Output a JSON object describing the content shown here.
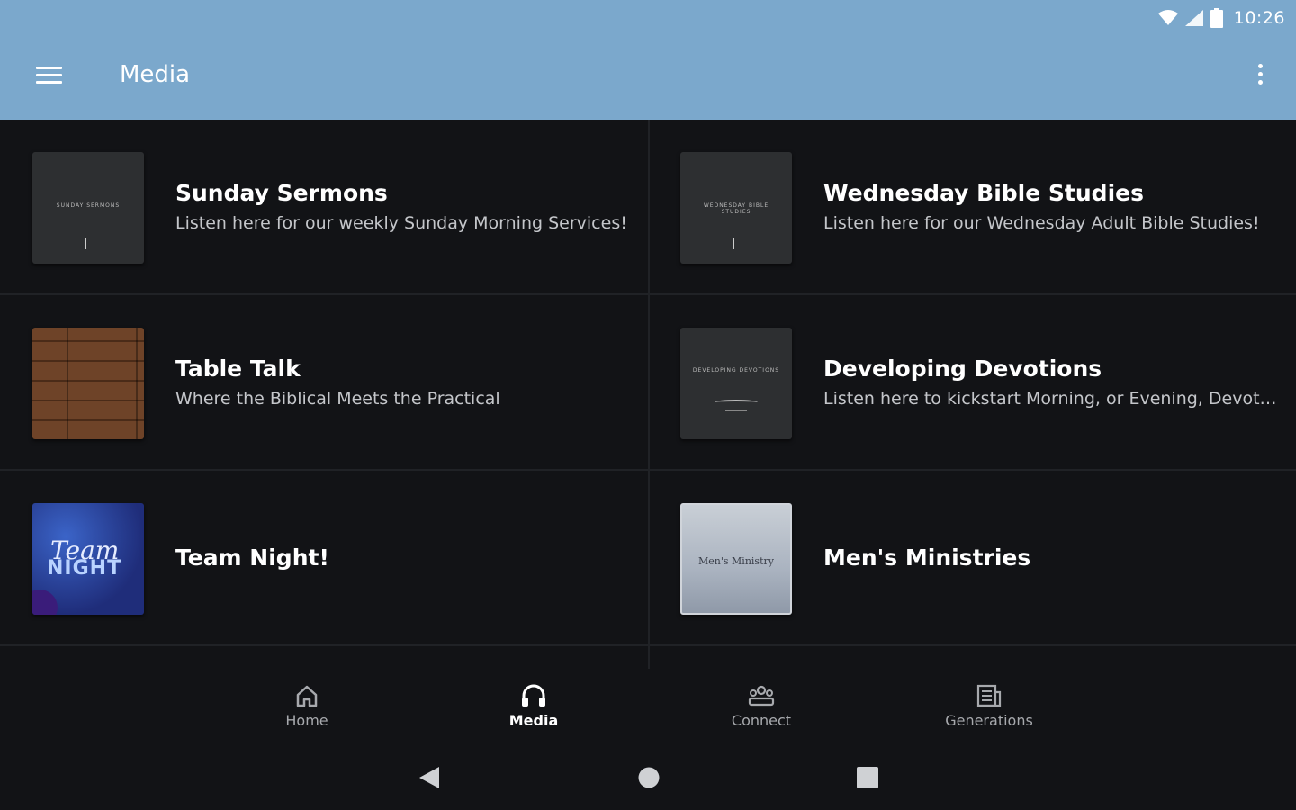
{
  "status_bar": {
    "time": "10:26",
    "icons": [
      "wifi-icon",
      "signal-icon",
      "battery-icon"
    ]
  },
  "app_bar": {
    "title": "Media",
    "background": "#7ba8cc",
    "menu_icon": "hamburger-menu-icon",
    "overflow_icon": "more-vert-icon"
  },
  "media_items": [
    {
      "title": "Sunday Sermons",
      "subtitle": "Listen here for our weekly Sunday Morning Services!",
      "thumb_text": "SUNDAY SERMONS"
    },
    {
      "title": "Wednesday Bible Studies",
      "subtitle": "Listen here for our Wednesday Adult Bible Studies!",
      "thumb_text": "WEDNESDAY BIBLE STUDIES"
    },
    {
      "title": "Table Talk",
      "subtitle": "Where the Biblical Meets the Practical"
    },
    {
      "title": "Developing Devotions",
      "subtitle": "Listen here to kickstart Morning, or Evening, Devoti...",
      "thumb_text": "DEVELOPING DEVOTIONS"
    },
    {
      "title": "Team Night!",
      "subtitle": "",
      "thumb_text_1": "Team",
      "thumb_text_2": "NIGHT"
    },
    {
      "title": "Men's Ministries",
      "subtitle": "",
      "thumb_text": "Men's Ministry"
    }
  ],
  "bottom_nav": {
    "items": [
      {
        "label": "Home",
        "icon": "home-icon"
      },
      {
        "label": "Media",
        "icon": "headphones-icon",
        "active": true
      },
      {
        "label": "Connect",
        "icon": "people-icon"
      },
      {
        "label": "Generations",
        "icon": "newspaper-icon"
      }
    ]
  },
  "system_nav": {
    "icons": [
      "back-icon",
      "home-circle-icon",
      "recents-icon"
    ]
  }
}
